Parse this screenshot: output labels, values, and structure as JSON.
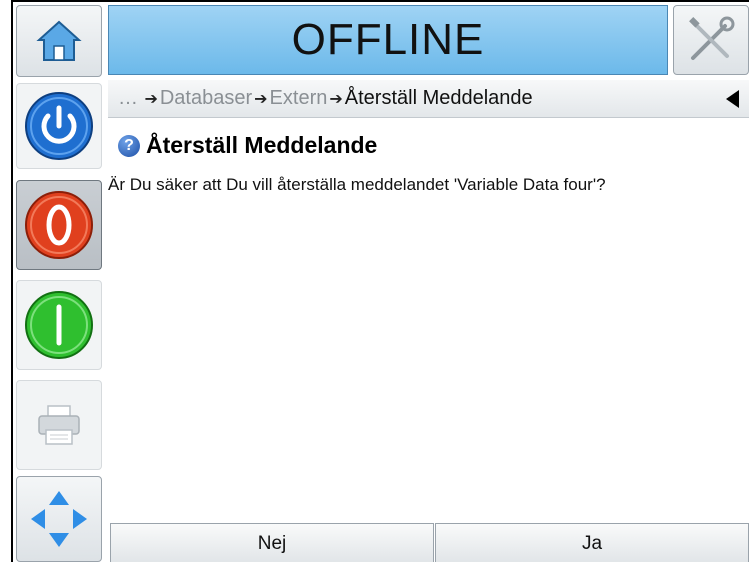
{
  "header": {
    "status": "OFFLINE"
  },
  "breadcrumb": {
    "ellipsis": "…",
    "items": [
      "Databaser",
      "Extern",
      "Återställ Meddelande"
    ]
  },
  "dialog": {
    "title": "Återställ Meddelande",
    "question_glyph": "?",
    "message": "Är Du säker att Du vill återställa meddelandet 'Variable Data four'?"
  },
  "footer": {
    "no_label": "Nej",
    "yes_label": "Ja"
  },
  "icons": {
    "home": "home-icon",
    "tools": "tools-icon",
    "power": "power-icon",
    "stop": "stop-icon",
    "start": "start-icon",
    "printer": "printer-icon",
    "navigation": "navigation-arrows-icon",
    "back": "back-arrow-icon"
  },
  "colors": {
    "status_banner": "#6cb9ea",
    "power": "#1f6fd0",
    "stop": "#e0401e",
    "start": "#2fbf2f"
  }
}
